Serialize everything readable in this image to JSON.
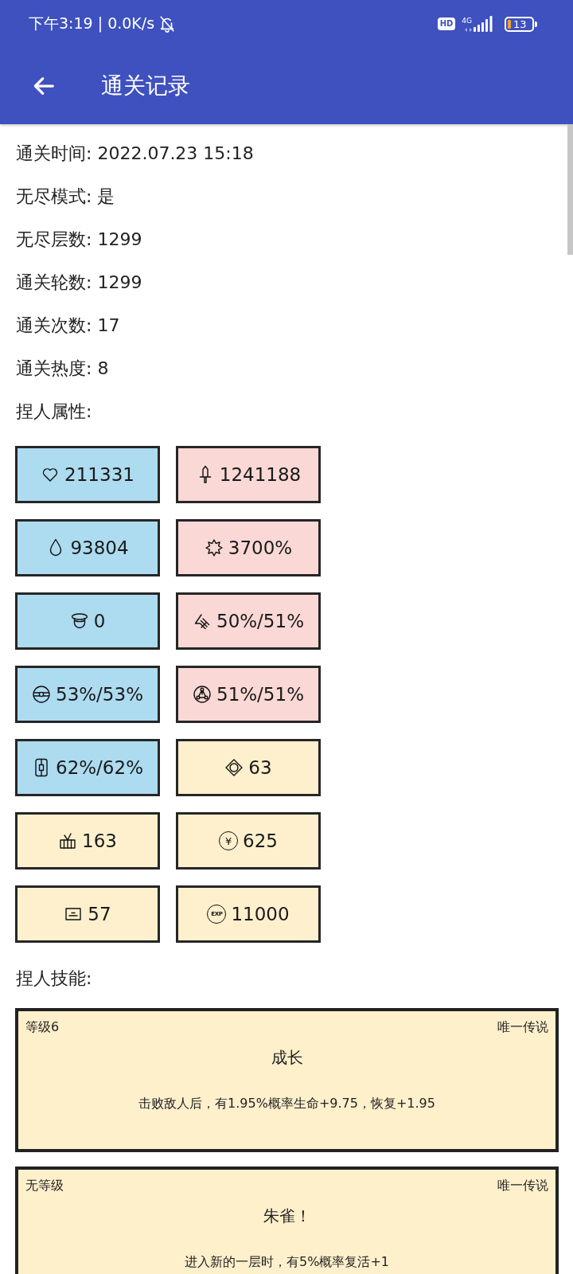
{
  "status_bar": {
    "time_and_speed": "下午3:19 | 0.0K/s",
    "hd_badge": "HD",
    "network_type": "4G",
    "battery": "13"
  },
  "app_bar": {
    "title": "通关记录"
  },
  "record_info": [
    "通关时间: 2022.07.23 15:18",
    "无尽模式: 是",
    "无尽层数: 1299",
    "通关轮数: 1299",
    "通关次数: 17",
    "通关热度: 8"
  ],
  "attributes_heading": "捏人属性:",
  "attributes": [
    {
      "kind": "heart",
      "value": "211331",
      "color": "#addbf0"
    },
    {
      "kind": "sword",
      "value": "1241188",
      "color": "#f9d8d5"
    },
    {
      "kind": "drop",
      "value": "93804",
      "color": "#addbf0"
    },
    {
      "kind": "burst",
      "value": "3700%",
      "color": "#f9d8d5"
    },
    {
      "kind": "hat",
      "value": "0",
      "color": "#addbf0"
    },
    {
      "kind": "claw",
      "value": "50%/51%",
      "color": "#f9d8d5"
    },
    {
      "kind": "ring",
      "value": "53%/53%",
      "color": "#addbf0"
    },
    {
      "kind": "nodes",
      "value": "51%/51%",
      "color": "#f9d8d5"
    },
    {
      "kind": "chip",
      "value": "62%/62%",
      "color": "#addbf0"
    },
    {
      "kind": "diamond",
      "value": "63",
      "color": "#fff0cd"
    },
    {
      "kind": "crate",
      "value": "163",
      "color": "#fff0cd"
    },
    {
      "kind": "coin",
      "badge": "¥",
      "value": "625",
      "color": "#fff0cd"
    },
    {
      "kind": "card",
      "value": "57",
      "color": "#fff0cd"
    },
    {
      "kind": "exp",
      "badge": "EXP",
      "value": "11000",
      "color": "#fff0cd"
    }
  ],
  "skills_heading": "捏人技能:",
  "skills": [
    {
      "level": "等级6",
      "rarity": "唯一传说",
      "name": "成长",
      "description": "击败敌人后，有1.95%概率生命+9.75，恢复+1.95"
    },
    {
      "level": "无等级",
      "rarity": "唯一传说",
      "name": "朱雀！",
      "description": "进入新的一层时，有5%概率复活+1"
    }
  ]
}
